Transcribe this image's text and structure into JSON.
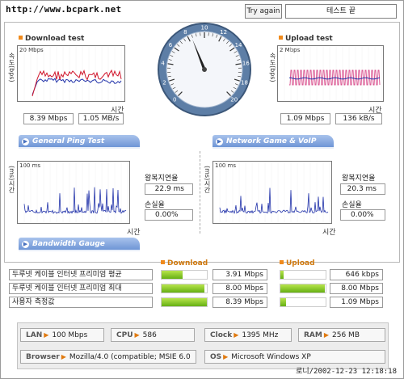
{
  "header": {
    "url": "http://www.bcpark.net",
    "try_again": "Try again",
    "test_end": "테스트 끝"
  },
  "download": {
    "title": "Download test",
    "ylabel": "속도(bps)",
    "scale": "20 Mbps",
    "time_label": "시간",
    "value_mbps": "8.39 Mbps",
    "value_mbs": "1.05 MB/s"
  },
  "upload": {
    "title": "Upload test",
    "ylabel": "속도(bps)",
    "scale": "2 Mbps",
    "time_label": "시간",
    "value_mbps": "1.09 Mbps",
    "value_kbs": "136 kB/s"
  },
  "gauge": {
    "ticks": [
      "0",
      "2",
      "4",
      "6",
      "8",
      "10",
      "12",
      "14",
      "16",
      "18",
      "20"
    ],
    "needle_value": 8.39
  },
  "ping": {
    "tab": "General Ping Test",
    "ylabel": "(ms)시간",
    "scale": "100 ms",
    "time_label": "시간",
    "rtt_label": "왕복지연율",
    "rtt_value": "22.9 ms",
    "loss_label": "손실율",
    "loss_value": "0.00%"
  },
  "game": {
    "tab": "Network Game & VoIP Test",
    "ylabel": "(ms)시간",
    "scale": "100 ms",
    "time_label": "시간",
    "rtt_label": "왕복지연율",
    "rtt_value": "20.3 ms",
    "loss_label": "손실율",
    "loss_value": "0.00%"
  },
  "bandwidth": {
    "tab": "Bandwidth Gauge",
    "download_header": "Download",
    "upload_header": "Upload",
    "rows": [
      {
        "label": "두루넷 케이블 인터넷 프리미엄 평균",
        "down": "3.91 Mbps",
        "down_fraction": 0.47,
        "up": "646 kbps",
        "up_fraction": 0.07
      },
      {
        "label": "두루넷 케이블 인터넷 프리미엄 최대",
        "down": "8.00 Mbps",
        "down_fraction": 0.95,
        "up": "8.00 Mbps",
        "up_fraction": 0.98
      },
      {
        "label": "사용자 측정값",
        "down": "8.39 Mbps",
        "down_fraction": 1.0,
        "up": "1.09 Mbps",
        "up_fraction": 0.13
      }
    ]
  },
  "system": {
    "lan_label": "LAN",
    "lan_value": "100 Mbps",
    "cpu_label": "CPU",
    "cpu_value": "586",
    "clock_label": "Clock",
    "clock_value": "1395 MHz",
    "ram_label": "RAM",
    "ram_value": "256 MB",
    "browser_label": "Browser",
    "browser_value": "Mozilla/4.0 (compatible; MSIE 6.0",
    "os_label": "OS",
    "os_value": "Microsoft Windows XP"
  },
  "footer": {
    "stamp": "로니/2002-12-23 12:18:18"
  },
  "colors": {
    "pill_blue": "#6e95d6",
    "accent_orange": "#f08a1c",
    "bar_green": "#66b014",
    "line_red": "#d0142a",
    "line_blue": "#2233aa"
  }
}
